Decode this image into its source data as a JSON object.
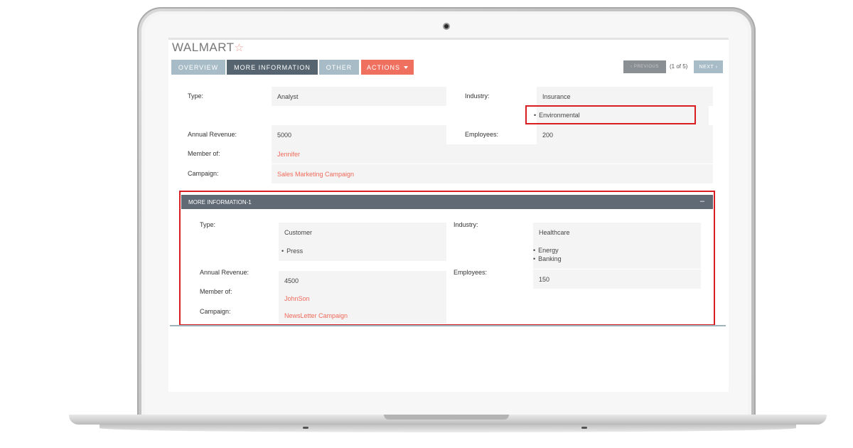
{
  "record": {
    "title": "WALMART",
    "star_icon": "star-outline-icon"
  },
  "tabs": [
    {
      "label": "OVERVIEW"
    },
    {
      "label": "MORE INFORMATION"
    },
    {
      "label": "OTHER"
    },
    {
      "label": "ACTIONS",
      "icon": "caret-down-icon"
    }
  ],
  "pagination": {
    "previous": "‹ PREVIOUS",
    "status": "(1 of 5)",
    "next": "NEXT ›"
  },
  "section1": {
    "type_label": "Type:",
    "type_value": "Analyst",
    "industry_label": "Industry:",
    "industry_value": "Insurance",
    "industry_extra": [
      "Environmental"
    ],
    "revenue_label": "Annual Revenue:",
    "revenue_value": "5000",
    "employees_label": "Employees:",
    "employees_value": "200",
    "member_label": "Member of:",
    "member_value": "Jennifer",
    "campaign_label": "Campaign:",
    "campaign_value": "Sales Marketing Campaign"
  },
  "panel": {
    "title": "MORE INFORMATION-1",
    "toggle": "–",
    "type_label": "Type:",
    "type_value": "Customer",
    "type_extra": [
      "Press"
    ],
    "industry_label": "Industry:",
    "industry_value": "Healthcare",
    "industry_extra": [
      "Energy",
      "Banking"
    ],
    "revenue_label": "Annual Revenue:",
    "revenue_value": "4500",
    "employees_label": "Employees:",
    "employees_value": "150",
    "member_label": "Member of:",
    "member_value": "JohnSon",
    "campaign_label": "Campaign:",
    "campaign_value": "NewsLetter Campaign"
  },
  "colors": {
    "accent": "#f07060",
    "tab_active": "#56646f",
    "tab_inactive": "#a7bcc6",
    "highlight": "#d81e22",
    "link": "#f0695a"
  }
}
